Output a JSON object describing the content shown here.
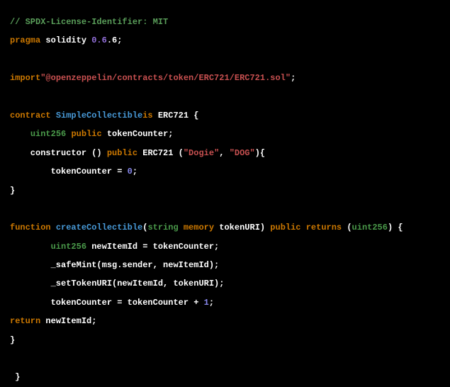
{
  "lines": [
    {
      "cls": "",
      "spans": [
        {
          "c": "t-comment",
          "t": "// SPDX-License-Identifier: MIT"
        }
      ]
    },
    {
      "cls": "",
      "spans": [
        {
          "c": "t-keyword",
          "t": "pragma"
        },
        {
          "c": "t-white",
          "t": " solidity "
        },
        {
          "c": "t-purple",
          "t": "0.6"
        },
        {
          "c": "t-white",
          "t": ".6;"
        }
      ]
    },
    {
      "cls": "blank",
      "spans": []
    },
    {
      "cls": "",
      "spans": [
        {
          "c": "t-keyword",
          "t": "import"
        },
        {
          "c": "t-string",
          "t": "\"@openzeppelin/contracts/token/ERC721/ERC721.sol\""
        },
        {
          "c": "t-white",
          "t": ";"
        }
      ]
    },
    {
      "cls": "blank",
      "spans": []
    },
    {
      "cls": "",
      "spans": [
        {
          "c": "t-keyword",
          "t": "contract"
        },
        {
          "c": "t-white",
          "t": " "
        },
        {
          "c": "t-ident",
          "t": "SimpleCollectible"
        },
        {
          "c": "t-keyword",
          "t": "is"
        },
        {
          "c": "t-white",
          "t": " ERC721 {"
        }
      ]
    },
    {
      "cls": "",
      "spans": [
        {
          "c": "t-white",
          "t": "    "
        },
        {
          "c": "t-type",
          "t": "uint256"
        },
        {
          "c": "t-white",
          "t": " "
        },
        {
          "c": "t-keyword",
          "t": "public"
        },
        {
          "c": "t-white",
          "t": " tokenCounter;"
        }
      ]
    },
    {
      "cls": "",
      "spans": [
        {
          "c": "t-white",
          "t": "    constructor () "
        },
        {
          "c": "t-keyword",
          "t": "public"
        },
        {
          "c": "t-white",
          "t": " ERC721 ("
        },
        {
          "c": "t-string",
          "t": "\"Dogie\""
        },
        {
          "c": "t-white",
          "t": ", "
        },
        {
          "c": "t-string",
          "t": "\"DOG\""
        },
        {
          "c": "t-white",
          "t": "){"
        }
      ]
    },
    {
      "cls": "",
      "spans": [
        {
          "c": "t-white",
          "t": "        tokenCounter = "
        },
        {
          "c": "t-number",
          "t": "0"
        },
        {
          "c": "t-white",
          "t": ";"
        }
      ]
    },
    {
      "cls": "",
      "spans": [
        {
          "c": "t-white",
          "t": "}"
        }
      ]
    },
    {
      "cls": "blank",
      "spans": []
    },
    {
      "cls": "",
      "spans": [
        {
          "c": "t-keyword",
          "t": "function"
        },
        {
          "c": "t-white",
          "t": " "
        },
        {
          "c": "t-ident",
          "t": "createCollectible"
        },
        {
          "c": "t-white",
          "t": "("
        },
        {
          "c": "t-type",
          "t": "string"
        },
        {
          "c": "t-white",
          "t": " "
        },
        {
          "c": "t-keyword",
          "t": "memory"
        },
        {
          "c": "t-white",
          "t": " tokenURI) "
        },
        {
          "c": "t-keyword",
          "t": "public"
        },
        {
          "c": "t-white",
          "t": " "
        },
        {
          "c": "t-keyword",
          "t": "returns"
        },
        {
          "c": "t-white",
          "t": " ("
        },
        {
          "c": "t-type",
          "t": "uint256"
        },
        {
          "c": "t-white",
          "t": ") {"
        }
      ]
    },
    {
      "cls": "",
      "spans": [
        {
          "c": "t-white",
          "t": "        "
        },
        {
          "c": "t-type",
          "t": "uint256"
        },
        {
          "c": "t-white",
          "t": " newItemId = tokenCounter;"
        }
      ]
    },
    {
      "cls": "",
      "spans": [
        {
          "c": "t-white",
          "t": "        _safeMint(msg.sender, newItemId);"
        }
      ]
    },
    {
      "cls": "",
      "spans": [
        {
          "c": "t-white",
          "t": "        _setTokenURI(newItemId, tokenURI);"
        }
      ]
    },
    {
      "cls": "",
      "spans": [
        {
          "c": "t-white",
          "t": "        tokenCounter = tokenCounter + "
        },
        {
          "c": "t-number",
          "t": "1"
        },
        {
          "c": "t-white",
          "t": ";"
        }
      ]
    },
    {
      "cls": "",
      "spans": [
        {
          "c": "t-keyword",
          "t": "return"
        },
        {
          "c": "t-white",
          "t": " newItemId;"
        }
      ]
    },
    {
      "cls": "",
      "spans": [
        {
          "c": "t-white",
          "t": "}"
        }
      ]
    },
    {
      "cls": "blank",
      "spans": []
    },
    {
      "cls": "",
      "spans": [
        {
          "c": "t-white",
          "t": " }"
        }
      ]
    }
  ]
}
